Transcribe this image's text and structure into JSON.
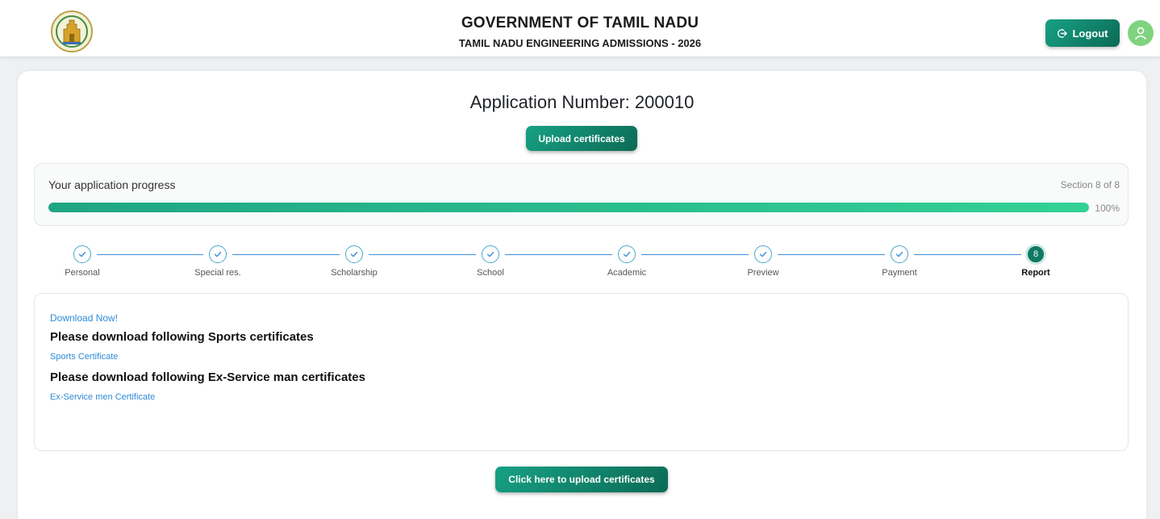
{
  "header": {
    "title": "GOVERNMENT OF TAMIL NADU",
    "subtitle": "TAMIL NADU ENGINEERING ADMISSIONS - 2026",
    "logout_label": "Logout"
  },
  "main": {
    "application_number": "Application Number: 200010",
    "upload_top_label": "Upload certificates",
    "upload_bottom_label": "Click here to upload certificates"
  },
  "progress": {
    "label": "Your application progress",
    "section": "Section 8 of 8",
    "percent_text": "100%",
    "percent": 100
  },
  "steps": [
    {
      "label": "Personal",
      "state": "done"
    },
    {
      "label": "Special res.",
      "state": "done"
    },
    {
      "label": "Scholarship",
      "state": "done"
    },
    {
      "label": "School",
      "state": "done"
    },
    {
      "label": "Academic",
      "state": "done"
    },
    {
      "label": "Preview",
      "state": "done"
    },
    {
      "label": "Payment",
      "state": "done"
    },
    {
      "label": "Report",
      "state": "active",
      "number": "8"
    }
  ],
  "content": {
    "download_now": "Download Now!",
    "sports_heading": "Please download following Sports certificates",
    "sports_link": "Sports Certificate",
    "exservice_heading": "Please download following Ex-Service man certificates",
    "exservice_link": "Ex-Service men Certificate"
  },
  "colors": {
    "accent": "#0f7a64",
    "progress_fill": "#2ec08f",
    "link": "#2f8bd8",
    "avatar": "#7fd37f"
  }
}
